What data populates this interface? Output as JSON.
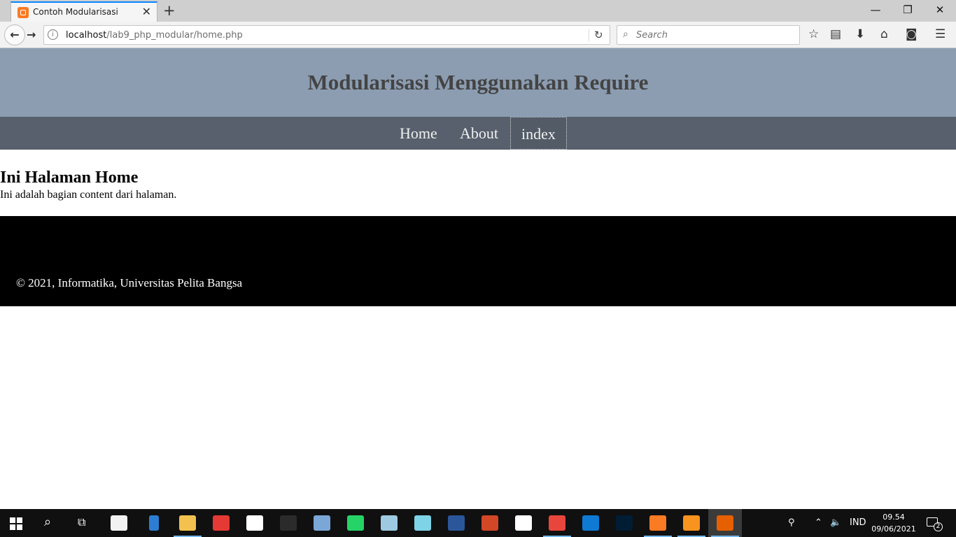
{
  "browser": {
    "tab_title": "Contoh Modularisasi",
    "url_host": "localhost",
    "url_path": "/lab9_php_modular/home.php",
    "search_placeholder": "Search"
  },
  "page": {
    "header_title": "Modularisasi Menggunakan Require",
    "nav": [
      {
        "label": "Home",
        "active": false
      },
      {
        "label": "About",
        "active": false
      },
      {
        "label": "index",
        "active": true
      }
    ],
    "content_heading": "Ini Halaman Home",
    "content_text": "Ini adalah bagian content dari halaman.",
    "footer_text": "© 2021, Informatika, Universitas Pelita Bangsa"
  },
  "taskbar": {
    "apps": [
      {
        "name": "file-explorer",
        "color": "#f2c14e",
        "running": true
      },
      {
        "name": "gift-app",
        "color": "#e53935",
        "running": false
      },
      {
        "name": "mail-app",
        "color": "#ffffff",
        "running": false
      },
      {
        "name": "terminal-app",
        "color": "#2b2b2b",
        "running": false
      },
      {
        "name": "virtualbox-app",
        "color": "#7aa7d6",
        "running": false
      },
      {
        "name": "whatsapp-app",
        "color": "#25d366",
        "running": false
      },
      {
        "name": "paint-app",
        "color": "#9ecae1",
        "running": false
      },
      {
        "name": "notes-app",
        "color": "#7fd3e6",
        "running": false
      },
      {
        "name": "word-app",
        "color": "#2b579a",
        "running": false
      },
      {
        "name": "presentation-app",
        "color": "#d24726",
        "running": false
      },
      {
        "name": "word-doc-app",
        "color": "#ffffff",
        "running": false
      },
      {
        "name": "chrome-app",
        "color": "#e8453c",
        "running": true
      },
      {
        "name": "vscode-app",
        "color": "#0e7ad3",
        "running": false
      },
      {
        "name": "photoshop-app",
        "color": "#001d34",
        "running": false
      },
      {
        "name": "xampp-app",
        "color": "#fb7a24",
        "running": true
      },
      {
        "name": "sublime-app",
        "color": "#f7931e",
        "running": true
      },
      {
        "name": "firefox-app",
        "color": "#e66000",
        "running": true,
        "active": true
      }
    ],
    "language": "IND",
    "time": "09.54",
    "date": "09/06/2021",
    "notification_count": "2"
  }
}
